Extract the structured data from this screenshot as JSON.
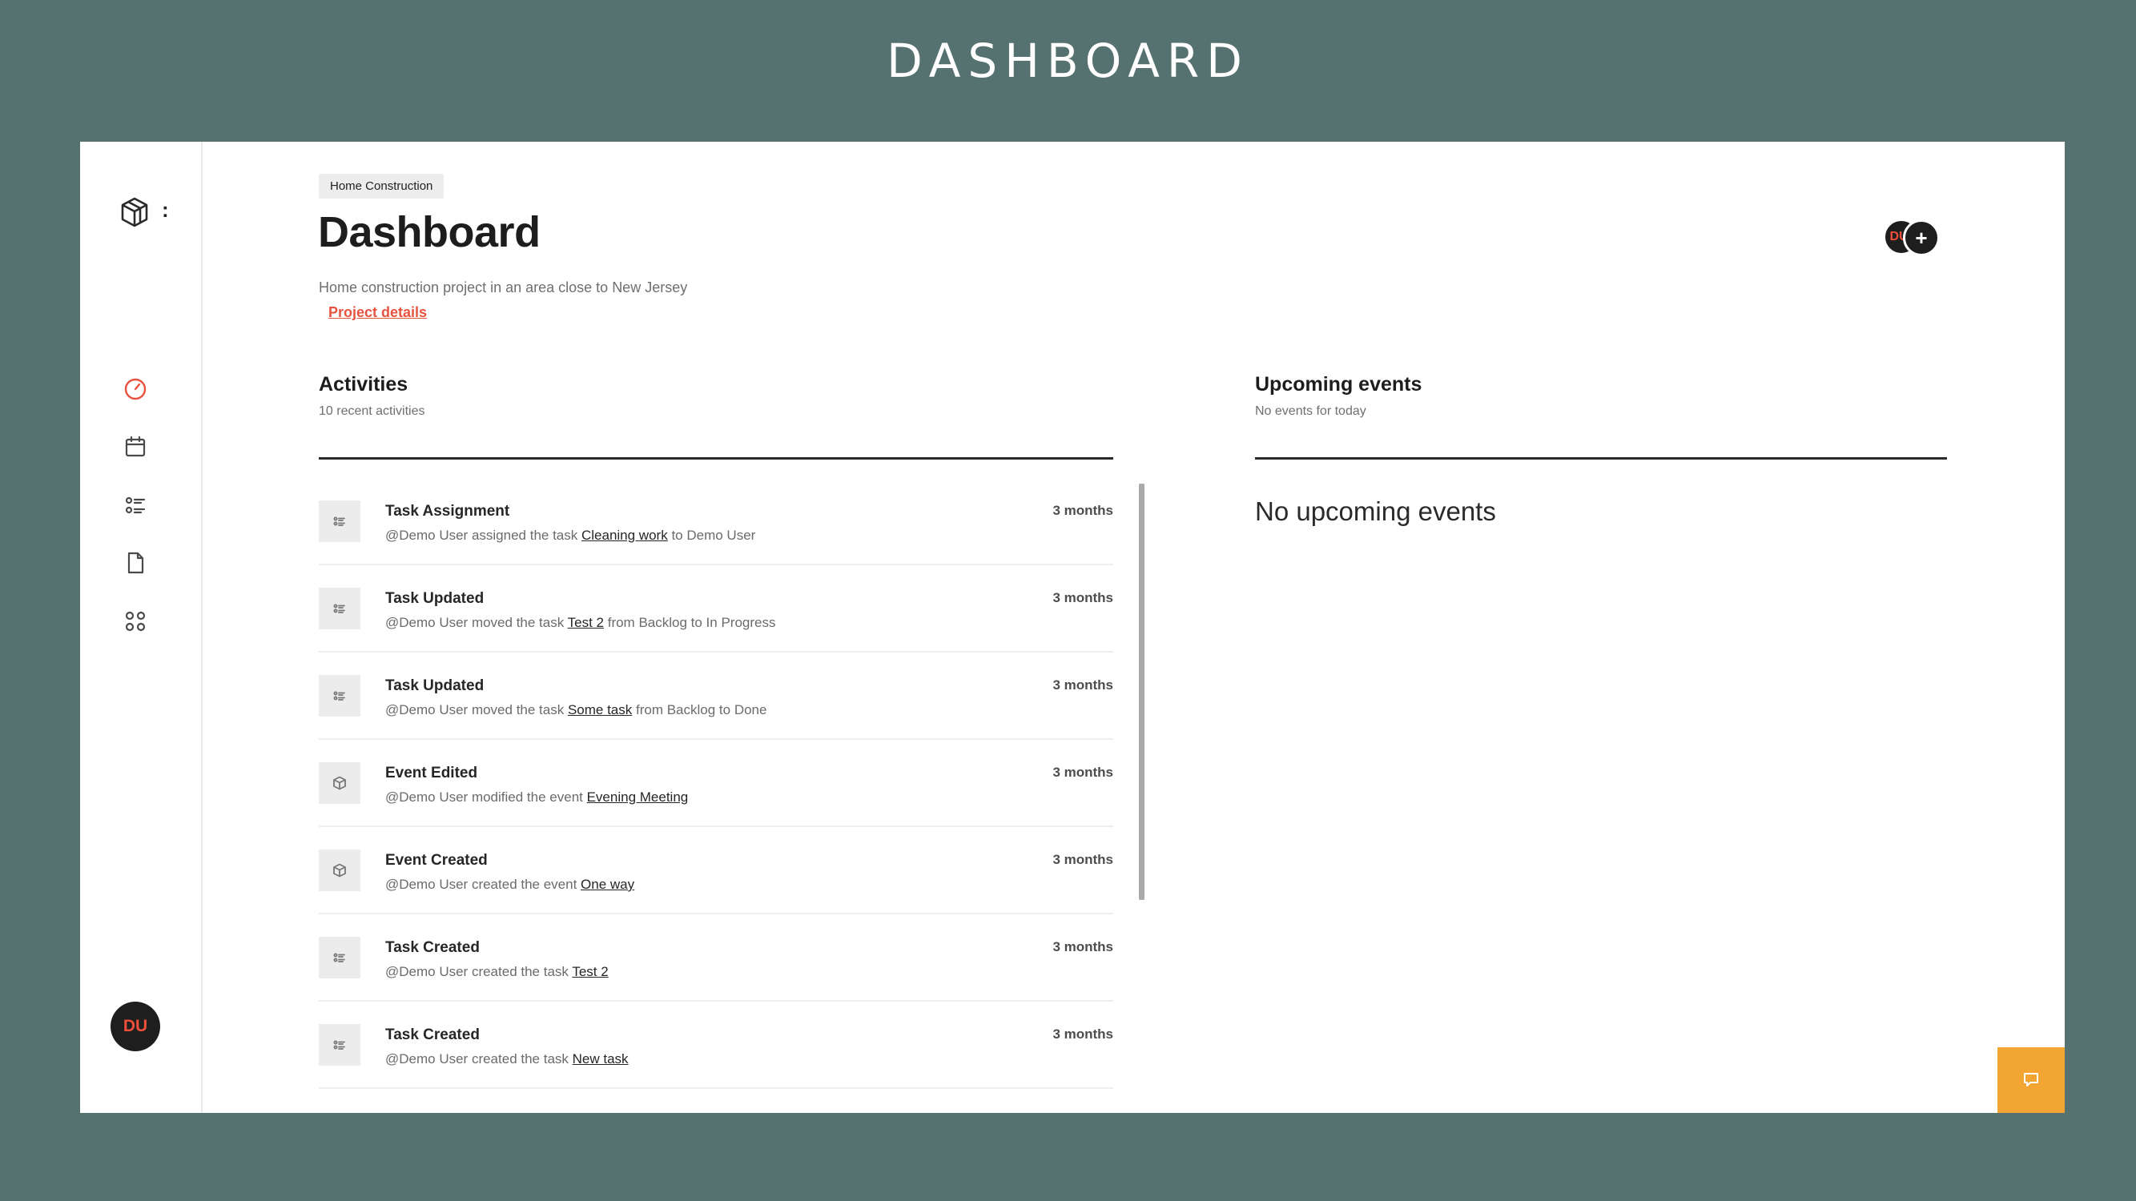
{
  "slide": {
    "title": "DASHBOARD"
  },
  "sidebar": {
    "logo": "cube-logo-icon",
    "menu_icon": "more-vertical-icon",
    "menu_glyph": ":",
    "items": [
      {
        "icon": "dashboard-gauge-icon",
        "active": true
      },
      {
        "icon": "calendar-icon",
        "active": false
      },
      {
        "icon": "task-list-icon",
        "active": false
      },
      {
        "icon": "document-icon",
        "active": false
      },
      {
        "icon": "apps-grid-icon",
        "active": false
      }
    ],
    "user_initials": "DU"
  },
  "header": {
    "breadcrumb": "Home Construction",
    "title": "Dashboard",
    "description": "Home construction project in an area close to New Jersey",
    "project_link": "Project details",
    "member_initials": "DU",
    "add_member": "+"
  },
  "activities": {
    "title": "Activities",
    "subtitle": "10 recent activities",
    "items": [
      {
        "icon": "task-list-icon",
        "title": "Task Assignment",
        "time": "3 months",
        "before": "@Demo User assigned the task ",
        "link": "Cleaning work",
        "after": " to Demo User"
      },
      {
        "icon": "task-list-icon",
        "title": "Task Updated",
        "time": "3 months",
        "before": "@Demo User moved the task ",
        "link": "Test 2",
        "after": " from Backlog to In Progress"
      },
      {
        "icon": "task-list-icon",
        "title": "Task Updated",
        "time": "3 months",
        "before": "@Demo User moved the task ",
        "link": "Some task",
        "after": " from Backlog to Done"
      },
      {
        "icon": "cube-icon",
        "title": "Event Edited",
        "time": "3 months",
        "before": "@Demo User modified the event ",
        "link": "Evening Meeting",
        "after": ""
      },
      {
        "icon": "cube-icon",
        "title": "Event Created",
        "time": "3 months",
        "before": "@Demo User created the event ",
        "link": "One way",
        "after": ""
      },
      {
        "icon": "task-list-icon",
        "title": "Task Created",
        "time": "3 months",
        "before": "@Demo User created the task ",
        "link": "Test 2",
        "after": ""
      },
      {
        "icon": "task-list-icon",
        "title": "Task Created",
        "time": "3 months",
        "before": "@Demo User created the task ",
        "link": "New task",
        "after": ""
      }
    ]
  },
  "events": {
    "title": "Upcoming events",
    "subtitle": "No events for today",
    "empty_message": "No upcoming events"
  },
  "chat": {
    "icon": "chat-bubble-icon"
  },
  "colors": {
    "accent": "#e8533f",
    "background": "#557170",
    "chat_button": "#f3a533"
  }
}
